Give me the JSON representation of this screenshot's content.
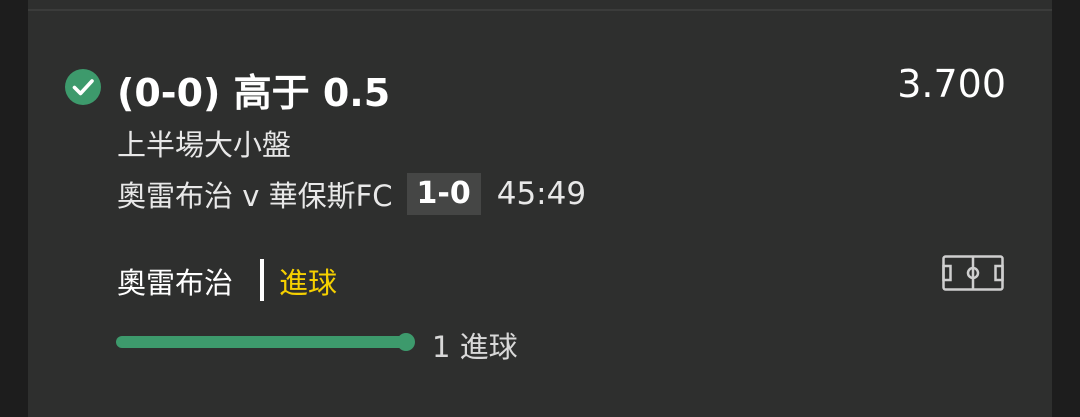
{
  "bet": {
    "selection": "(0-0) 高于 0.5",
    "odds": "3.700",
    "market": "上半場大小盤",
    "status": "settled-won"
  },
  "event": {
    "name": "奧雷布治 v 華保斯FC",
    "score": "1-0",
    "clock": "45:49"
  },
  "last_event": {
    "team": "奧雷布治",
    "type": "進球"
  },
  "progress": {
    "label": "1 進球",
    "fraction": 1.0
  },
  "icons": {
    "status": "check-circle-icon",
    "pitch": "football-pitch-icon"
  },
  "colors": {
    "accent_green": "#3d9a6c",
    "highlight_yellow": "#f5d000",
    "card_bg": "#2e2f2e",
    "score_bg": "#454645"
  }
}
